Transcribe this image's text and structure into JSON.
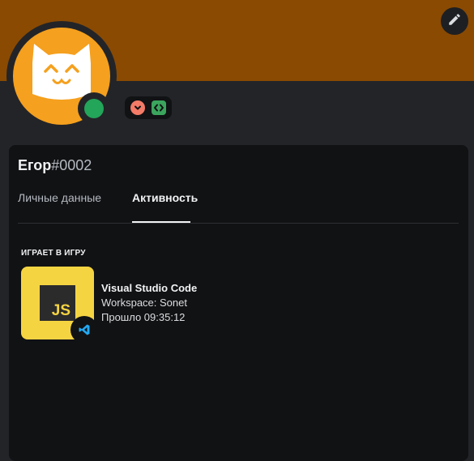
{
  "profile": {
    "username": "Егор",
    "discriminator": "#0002",
    "status": "online",
    "status_color": "#23a55a",
    "banner_color": "#8a4a02",
    "avatar_color": "#f5a01e",
    "avatar_icon": "cat-face-icon",
    "badges": [
      {
        "icon": "hypesquad-icon",
        "color": "#f47b67"
      },
      {
        "icon": "developer-badge-icon",
        "color": "#3ba55d"
      }
    ],
    "edit_icon": "pencil-icon"
  },
  "tabs": [
    {
      "label": "Личные данные",
      "active": false
    },
    {
      "label": "Активность",
      "active": true
    }
  ],
  "activity": {
    "section_label": "ИГРАЕТ В ИГРУ",
    "large_image_text": "JS",
    "large_image_color": "#f5d442",
    "small_image_icon": "vscode-icon",
    "small_image_color": "#23a9f2",
    "name": "Visual Studio Code",
    "details": "Workspace: Sonet",
    "elapsed": "Прошло 09:35:12"
  }
}
